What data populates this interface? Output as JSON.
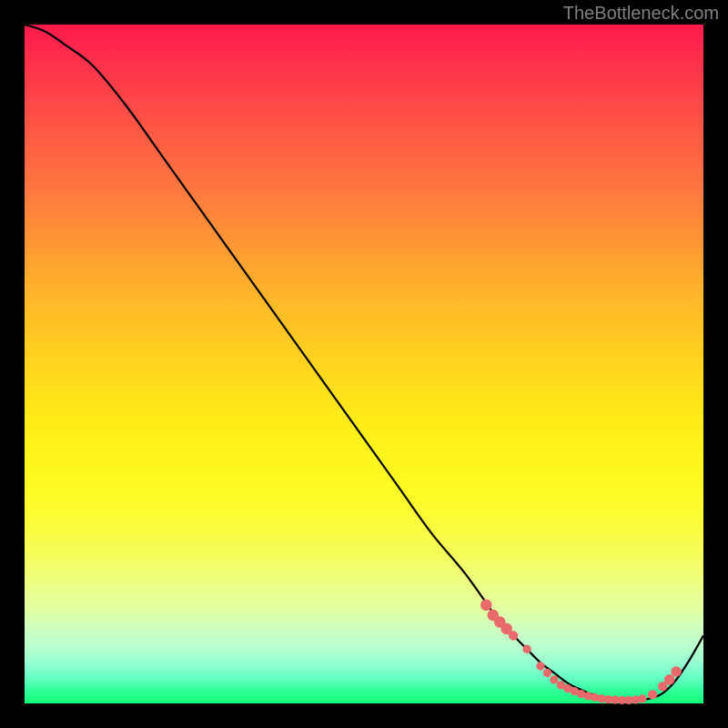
{
  "attribution": "TheBottleneck.com",
  "colors": {
    "curve": "#000000",
    "dots": "#e96a6a",
    "gradient_top": "#ff1a4d",
    "gradient_bottom": "#12ff78"
  },
  "chart_data": {
    "type": "line",
    "title": "",
    "xlabel": "",
    "ylabel": "",
    "xlim": [
      0,
      100
    ],
    "ylim": [
      0,
      100
    ],
    "series": [
      {
        "name": "bottleneck-curve",
        "x": [
          0,
          3,
          6,
          10,
          15,
          20,
          25,
          30,
          35,
          40,
          45,
          50,
          55,
          60,
          65,
          70,
          72,
          74,
          76,
          78,
          80,
          82,
          84,
          86,
          88,
          90,
          92,
          94,
          96,
          98,
          100
        ],
        "y": [
          100,
          99,
          97,
          94,
          88,
          81,
          74,
          67,
          60,
          53,
          46,
          39,
          32,
          25,
          19,
          12,
          10,
          8,
          6,
          4.5,
          3,
          2,
          1.2,
          0.7,
          0.5,
          0.5,
          0.7,
          1.5,
          3.5,
          6.5,
          10
        ]
      }
    ],
    "highlight_dots": {
      "name": "sample-points",
      "color": "#e96a6a",
      "points": [
        {
          "x": 68,
          "y": 14.5,
          "r": 1.2
        },
        {
          "x": 69,
          "y": 13.0,
          "r": 1.2
        },
        {
          "x": 70,
          "y": 12.0,
          "r": 1.2
        },
        {
          "x": 71,
          "y": 11.0,
          "r": 1.2
        },
        {
          "x": 72,
          "y": 10.0,
          "r": 1.0
        },
        {
          "x": 74,
          "y": 8.0,
          "r": 0.9
        },
        {
          "x": 76,
          "y": 5.5,
          "r": 0.9
        },
        {
          "x": 77,
          "y": 4.5,
          "r": 0.9
        },
        {
          "x": 78,
          "y": 3.5,
          "r": 0.9
        },
        {
          "x": 79,
          "y": 2.7,
          "r": 0.9
        },
        {
          "x": 80,
          "y": 2.2,
          "r": 0.9
        },
        {
          "x": 81,
          "y": 1.8,
          "r": 0.9
        },
        {
          "x": 82,
          "y": 1.4,
          "r": 0.9
        },
        {
          "x": 83,
          "y": 1.1,
          "r": 0.9
        },
        {
          "x": 84,
          "y": 0.9,
          "r": 0.9
        },
        {
          "x": 85,
          "y": 0.7,
          "r": 0.9
        },
        {
          "x": 86,
          "y": 0.6,
          "r": 0.9
        },
        {
          "x": 87,
          "y": 0.55,
          "r": 0.9
        },
        {
          "x": 88,
          "y": 0.5,
          "r": 0.9
        },
        {
          "x": 89,
          "y": 0.5,
          "r": 0.9
        },
        {
          "x": 90,
          "y": 0.55,
          "r": 0.9
        },
        {
          "x": 91,
          "y": 0.7,
          "r": 0.9
        },
        {
          "x": 92.5,
          "y": 1.3,
          "r": 1.0
        },
        {
          "x": 94,
          "y": 2.5,
          "r": 1.0
        },
        {
          "x": 95,
          "y": 3.5,
          "r": 1.1
        },
        {
          "x": 96,
          "y": 4.7,
          "r": 1.1
        }
      ]
    }
  }
}
